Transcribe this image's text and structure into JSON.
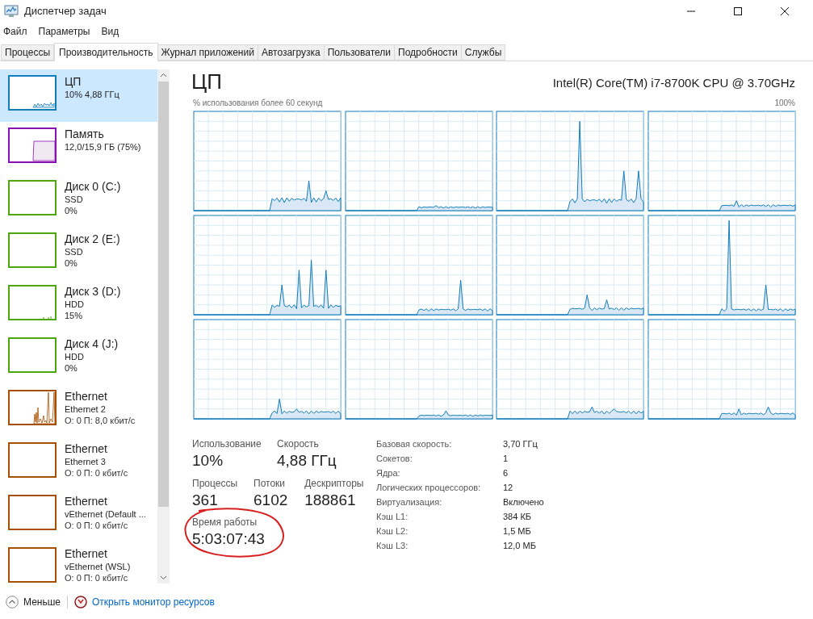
{
  "window": {
    "title": "Диспетчер задач"
  },
  "menu": [
    "Файл",
    "Параметры",
    "Вид"
  ],
  "tabs": [
    {
      "label": "Процессы",
      "selected": false
    },
    {
      "label": "Производительность",
      "selected": true
    },
    {
      "label": "Журнал приложений",
      "selected": false
    },
    {
      "label": "Автозагрузка",
      "selected": false
    },
    {
      "label": "Пользователи",
      "selected": false
    },
    {
      "label": "Подробности",
      "selected": false
    },
    {
      "label": "Службы",
      "selected": false
    }
  ],
  "sidebar": {
    "items": [
      {
        "kind": "cpu",
        "title": "ЦП",
        "lines": [
          "10% 4,88 ГГц"
        ],
        "color": "#117dbb",
        "selected": true
      },
      {
        "kind": "memory",
        "title": "Память",
        "lines": [
          "12,0/15,9 ГБ (75%)"
        ],
        "color": "#8b12ae",
        "selected": false
      },
      {
        "kind": "disk",
        "title": "Диск 0 (C:)",
        "lines": [
          "SSD",
          "0%"
        ],
        "color": "#4da60c",
        "selected": false
      },
      {
        "kind": "disk",
        "title": "Диск 2 (E:)",
        "lines": [
          "SSD",
          "0%"
        ],
        "color": "#4da60c",
        "selected": false
      },
      {
        "kind": "disk",
        "title": "Диск 3 (D:)",
        "lines": [
          "HDD",
          "15%"
        ],
        "color": "#4da60c",
        "selected": false
      },
      {
        "kind": "disk",
        "title": "Диск 4 (J:)",
        "lines": [
          "HDD",
          "0%"
        ],
        "color": "#4da60c",
        "selected": false
      },
      {
        "kind": "ethernet",
        "title": "Ethernet",
        "lines": [
          "Ethernet 2",
          "О: 0 П: 8,0 кбит/с"
        ],
        "color": "#a74f01",
        "selected": false
      },
      {
        "kind": "ethernet",
        "title": "Ethernet",
        "lines": [
          "Ethernet 3",
          "О: 0 П: 0 кбит/с"
        ],
        "color": "#a74f01",
        "selected": false
      },
      {
        "kind": "ethernet",
        "title": "Ethernet",
        "lines": [
          "vEthernet (Default ...",
          "О: 0 П: 0 кбит/с"
        ],
        "color": "#a74f01",
        "selected": false
      },
      {
        "kind": "ethernet",
        "title": "Ethernet",
        "lines": [
          "vEthernet (WSL)",
          "О: 0 П: 0 кбит/с"
        ],
        "color": "#a74f01",
        "selected": false
      }
    ]
  },
  "main": {
    "title": "ЦП",
    "model": "Intel(R) Core(TM) i7-8700K CPU @ 3.70GHz",
    "graph_caption": "% использования более 60 секунд",
    "graph_max": "100%",
    "stats": [
      {
        "label": "Использование",
        "value": "10%"
      },
      {
        "label": "Скорость",
        "value": "4,88 ГГц"
      }
    ],
    "counts": [
      {
        "label": "Процессы",
        "value": "361"
      },
      {
        "label": "Потоки",
        "value": "6102"
      },
      {
        "label": "Дескрипторы",
        "value": "188861"
      }
    ],
    "uptime": {
      "label": "Время работы",
      "value": "5:03:07:43"
    },
    "details": [
      {
        "label": "Базовая скорость:",
        "value": "3,70 ГГц"
      },
      {
        "label": "Сокетов:",
        "value": "1"
      },
      {
        "label": "Ядра:",
        "value": "6"
      },
      {
        "label": "Логических процессоров:",
        "value": "12"
      },
      {
        "label": "Виртуализация:",
        "value": "Включено"
      },
      {
        "label": "Кэш L1:",
        "value": "384 КБ"
      },
      {
        "label": "Кэш L2:",
        "value": "1,5 МБ"
      },
      {
        "label": "Кэш L3:",
        "value": "12,0 МБ"
      }
    ]
  },
  "footer": {
    "less": "Меньше",
    "link": "Открыть монитор ресурсов"
  }
}
